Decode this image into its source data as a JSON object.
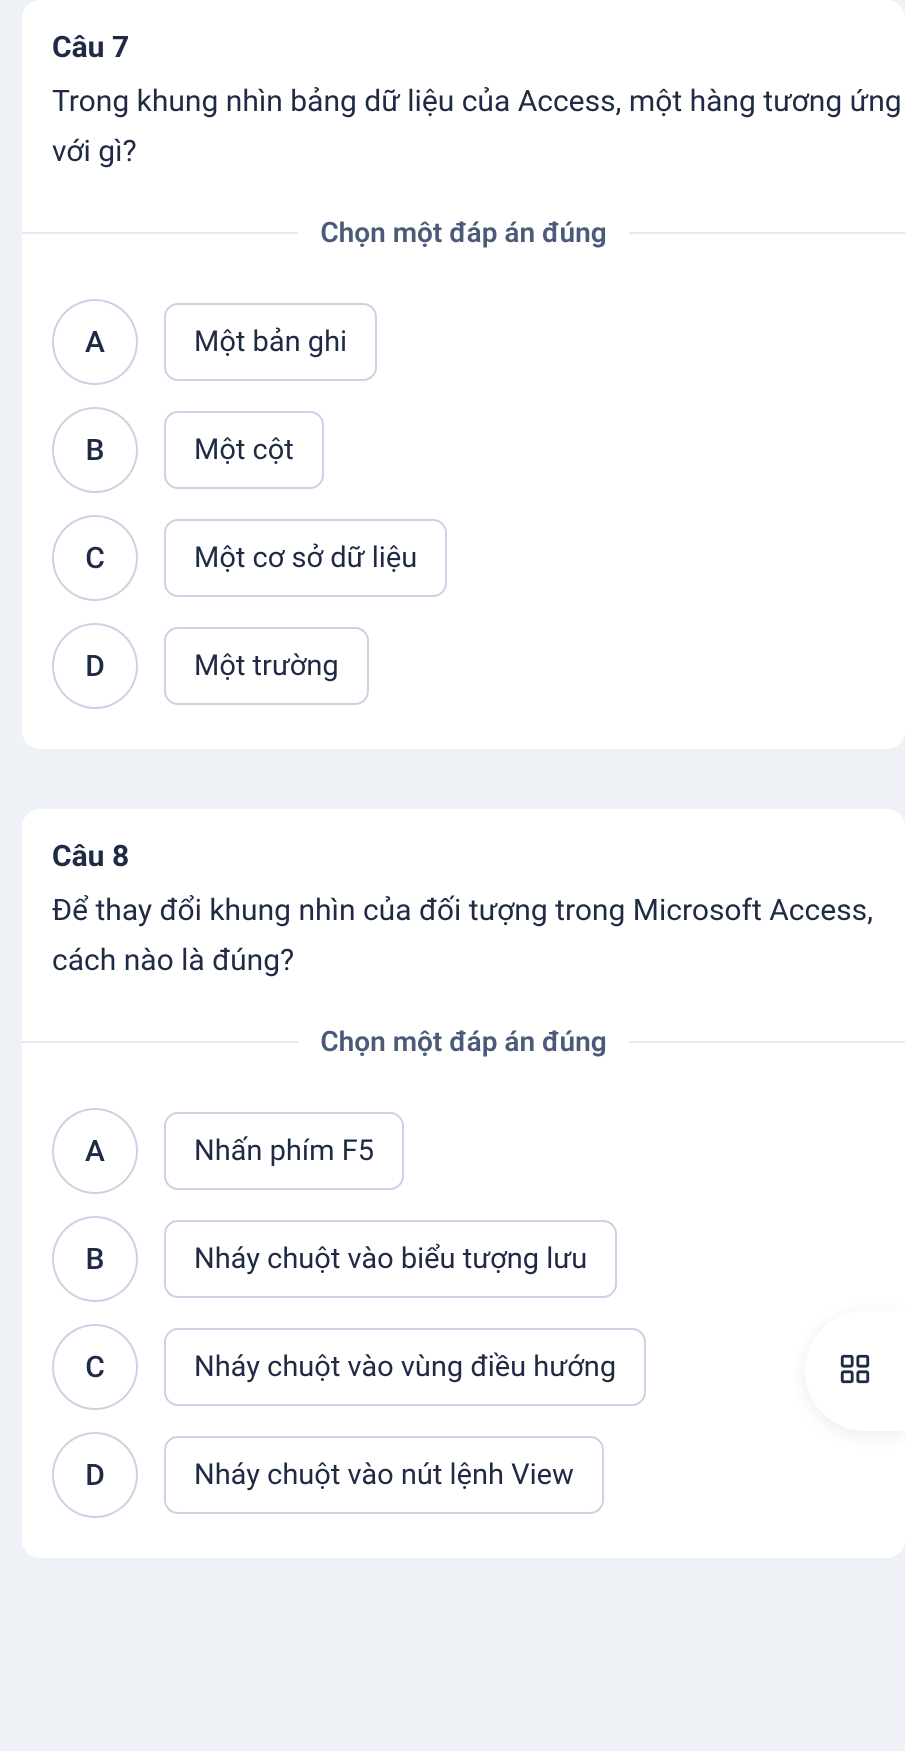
{
  "questions": [
    {
      "title": "Câu 7",
      "text": "Trong khung nhìn bảng dữ liệu của Access, một hàng tương ứng với gì?",
      "prompt": "Chọn một đáp án đúng",
      "options": [
        {
          "letter": "A",
          "label": "Một bản ghi"
        },
        {
          "letter": "B",
          "label": "Một cột"
        },
        {
          "letter": "C",
          "label": "Một cơ sở dữ liệu"
        },
        {
          "letter": "D",
          "label": "Một trường"
        }
      ]
    },
    {
      "title": "Câu 8",
      "text": "Để thay đổi khung nhìn của đối tượng trong Microsoft Access, cách nào là đúng?",
      "prompt": "Chọn một đáp án đúng",
      "options": [
        {
          "letter": "A",
          "label": "Nhấn phím F5"
        },
        {
          "letter": "B",
          "label": "Nháy chuột vào biểu tượng lưu"
        },
        {
          "letter": "C",
          "label": "Nháy chuột vào vùng điều hướng"
        },
        {
          "letter": "D",
          "label": "Nháy chuột vào nút lệnh View"
        }
      ]
    }
  ]
}
